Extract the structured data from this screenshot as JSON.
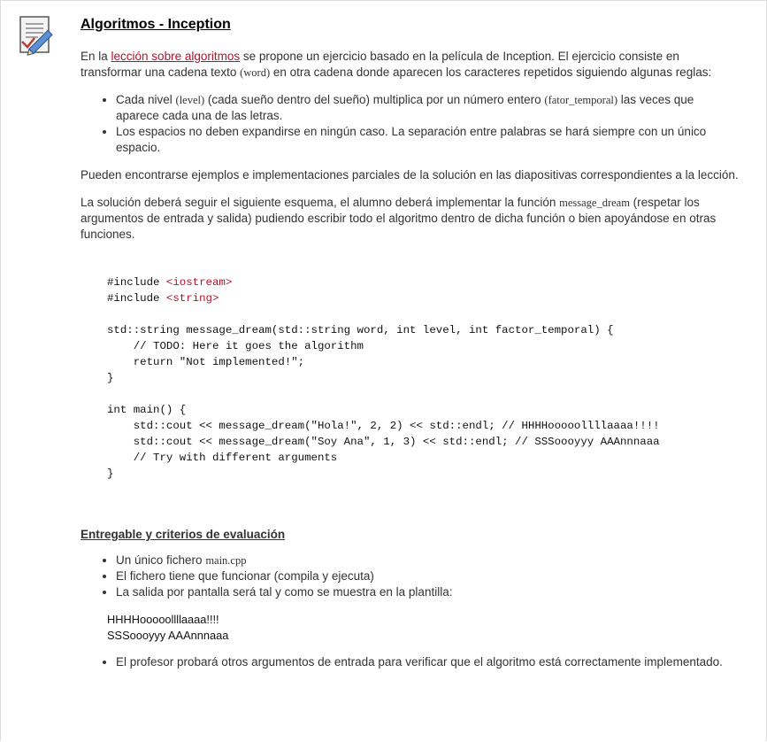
{
  "title": "Algoritmos - Inception",
  "intro": {
    "before_link": "En la ",
    "link_text": "lección sobre algoritmos",
    "after_link_1": " se propone un ejercicio basado en la película de Inception. El ejercicio consiste en transformar una cadena texto ",
    "word_code": "(word)",
    "after_link_2": " en otra cadena donde aparecen los caracteres repetidos siguiendo algunas reglas:"
  },
  "rules": {
    "rule1_a": "Cada nivel ",
    "rule1_code1": "(level)",
    "rule1_b": " (cada sueño dentro del sueño) multiplica por un número entero ",
    "rule1_code2": "(fator_temporal)",
    "rule1_c": " las veces que aparece cada una de las letras.",
    "rule2": "Los espacios no deben expandirse en ningún caso. La separación entre palabras se hará siempre con un único espacio."
  },
  "para2": "Pueden encontrarse ejemplos e implementaciones parciales de la solución en las diapositivas correspondientes a la lección.",
  "para3": {
    "a": "La solución deberá seguir el siguiente esquema, el alumno deberá implementar la función ",
    "code": "message_dream",
    "b": " (respetar los argumentos de entrada y salida) pudiendo escribir todo el algoritmo dentro de dicha función o bien apoyándose en otras funciones."
  },
  "code": {
    "inc1_pre": "#include ",
    "inc1_lib": "<iostream>",
    "inc2_pre": "#include ",
    "inc2_lib": "<string>",
    "rest": "\nstd::string message_dream(std::string word, int level, int factor_temporal) {\n    // TODO: Here it goes the algorithm\n    return \"Not implemented!\";\n}\n\nint main() {\n    std::cout << message_dream(\"Hola!\", 2, 2) << std::endl; // HHHHooooollllaaaa!!!!\n    std::cout << message_dream(\"Soy Ana\", 1, 3) << std::endl; // SSSoooyyy AAAnnnaaa\n    // Try with different arguments\n}"
  },
  "deliverable": {
    "heading": "Entregable y criterios de evaluación",
    "item1_a": "Un único fichero ",
    "item1_code": "main.cpp",
    "item2": "El fichero tiene que funcionar (compila y ejecuta)",
    "item3": "La salida por pantalla será tal y como se muestra en la plantilla:",
    "output_line1": "HHHHooooollllaaaa!!!!",
    "output_line2": "SSSoooyyy AAAnnnaaa",
    "item4": "El profesor probará otros argumentos de entrada para verificar que el algoritmo está correctamente implementado."
  }
}
